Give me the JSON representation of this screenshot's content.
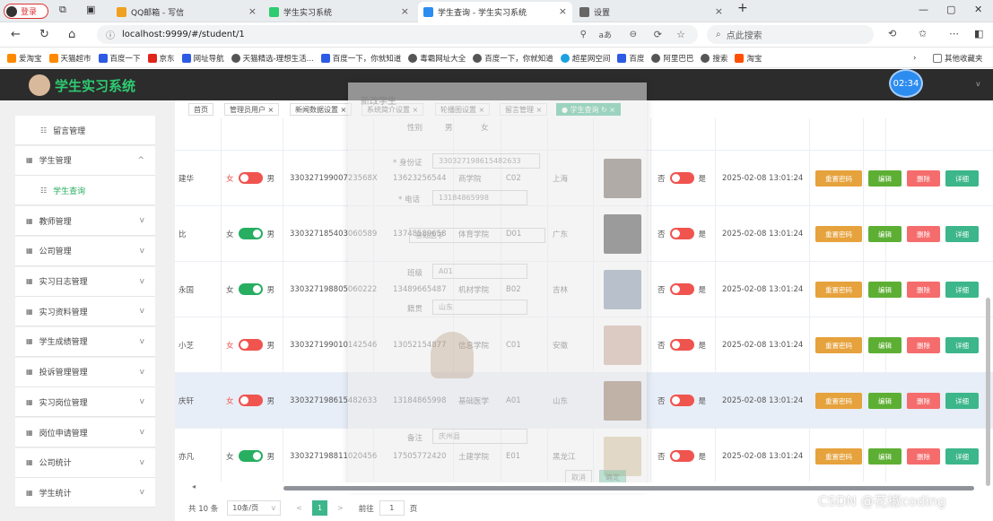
{
  "browser": {
    "login_label": "登录",
    "tabs": [
      {
        "title": "QQ邮箱 - 写信",
        "color": "#f0a020",
        "active": false
      },
      {
        "title": "学生实习系统",
        "color": "#2ecc71",
        "active": false
      },
      {
        "title": "学生查询 - 学生实习系统",
        "color": "#2d8cf0",
        "active": true
      },
      {
        "title": "设置",
        "color": "#666666",
        "active": false
      }
    ],
    "new_tab": "+",
    "url": "localhost:9999/#/student/1",
    "search_placeholder": "点此搜索",
    "bookmarks": [
      "爱淘宝",
      "天猫超市",
      "百度一下",
      "京东",
      "网址导航",
      "天猫精选-理想生活...",
      "百度一下，你就知道",
      "毒霸网址大全",
      "百度一下，你就知道",
      "超星网空间",
      "百度",
      "阿里巴巴",
      "搜索",
      "淘宝"
    ],
    "bookmarks_more": "其他收藏夹"
  },
  "app": {
    "title": "学生实习系统",
    "clock": "02:34"
  },
  "sidebar": {
    "items": [
      {
        "label": "留言管理",
        "sub": true,
        "selected": false,
        "chevron": ""
      },
      {
        "label": "学生管理",
        "sub": false,
        "selected": false,
        "chevron": "^"
      },
      {
        "label": "学生查询",
        "sub": true,
        "selected": true,
        "chevron": ""
      },
      {
        "label": "教师管理",
        "sub": false,
        "selected": false,
        "chevron": "v"
      },
      {
        "label": "公司管理",
        "sub": false,
        "selected": false,
        "chevron": "v"
      },
      {
        "label": "实习日志管理",
        "sub": false,
        "selected": false,
        "chevron": "v"
      },
      {
        "label": "实习资料管理",
        "sub": false,
        "selected": false,
        "chevron": "v"
      },
      {
        "label": "学生成绩管理",
        "sub": false,
        "selected": false,
        "chevron": "v"
      },
      {
        "label": "投诉管理管理",
        "sub": false,
        "selected": false,
        "chevron": "v"
      },
      {
        "label": "实习岗位管理",
        "sub": false,
        "selected": false,
        "chevron": "v"
      },
      {
        "label": "岗位申请管理",
        "sub": false,
        "selected": false,
        "chevron": "v"
      },
      {
        "label": "公司统计",
        "sub": false,
        "selected": false,
        "chevron": "v"
      },
      {
        "label": "学生统计",
        "sub": false,
        "selected": false,
        "chevron": "v"
      }
    ]
  },
  "tags": [
    {
      "label": "首页",
      "active": false
    },
    {
      "label": "管理员用户 ×",
      "active": false
    },
    {
      "label": "新闻数据设置 ×",
      "active": false
    },
    {
      "label": "系统简介设置 ×",
      "active": false
    },
    {
      "label": "轮播图设置 ×",
      "active": false
    },
    {
      "label": "留言管理 ×",
      "active": false
    },
    {
      "label": "● 学生查询 ↻ ×",
      "active": true
    }
  ],
  "switch_labels": {
    "female": "女",
    "male": "男",
    "no": "否",
    "yes": "是"
  },
  "actions": {
    "reset": "重置密码",
    "edit": "编辑",
    "delete": "删除",
    "detail": "详细"
  },
  "rows": [
    {
      "name": "建华",
      "gender_on": false,
      "idcard": "330327199007235​68X",
      "phone": "13623256544",
      "college": "商学院",
      "class": "C02",
      "origin": "上海",
      "photo": "#6b5d55",
      "status_on": false,
      "time": "2025-02-08 13:01:24"
    },
    {
      "name": "比",
      "gender_on": true,
      "idcard": "330327185403060589",
      "phone": "13748589658",
      "college": "体育学院",
      "class": "D01",
      "origin": "广东",
      "photo": "#3a3a3a",
      "status_on": false,
      "time": "2025-02-08 13:01:24"
    },
    {
      "name": "永国",
      "gender_on": true,
      "idcard": "330327198805060222",
      "phone": "13489665487",
      "college": "机材学院",
      "class": "B02",
      "origin": "吉林",
      "photo": "#7a8fa5",
      "status_on": false,
      "time": "2025-02-08 13:01:24"
    },
    {
      "name": "小芝",
      "gender_on": false,
      "idcard": "330327199010142546",
      "phone": "13052154877",
      "college": "信息学院",
      "class": "C01",
      "origin": "安徽",
      "photo": "#c9a493",
      "status_on": false,
      "time": "2025-02-08 13:01:24"
    },
    {
      "name": "庆轩",
      "gender_on": false,
      "idcard": "330327198615482633",
      "phone": "13184865998",
      "college": "基础医学",
      "class": "A01",
      "origin": "山东",
      "photo": "#8c6e55",
      "status_on": false,
      "time": "2025-02-08 13:01:24"
    },
    {
      "name": "亦凡",
      "gender_on": true,
      "idcard": "330327198811020456",
      "phone": "17505772420",
      "college": "土建学院",
      "class": "E01",
      "origin": "黑龙江",
      "photo": "#d8c19c",
      "status_on": false,
      "time": "2025-02-08 13:01:24"
    }
  ],
  "dialog": {
    "title": "新改学生",
    "gender_label": "性别",
    "gender_opt1": "男",
    "gender_opt2": "女",
    "idcard_label": "* 身份证",
    "idcard_value": "330327198615482633",
    "phone_label": "* 电话",
    "phone_value": "13184865998",
    "college_value": "基础医学",
    "class_label": "班级",
    "class_value": "A01",
    "origin_label": "籍贯",
    "origin_value": "山东",
    "remark_label": "备注",
    "remark_value": "庆州县",
    "cancel": "取消",
    "confirm": "确定"
  },
  "pager": {
    "total": "共 10 条",
    "page_size": "10条/页",
    "prev": "<",
    "current": "1",
    "next": ">",
    "goto_label": "前往",
    "goto_value": "1",
    "page_suffix": "页"
  },
  "watermark": "CSDN @花椒coding"
}
